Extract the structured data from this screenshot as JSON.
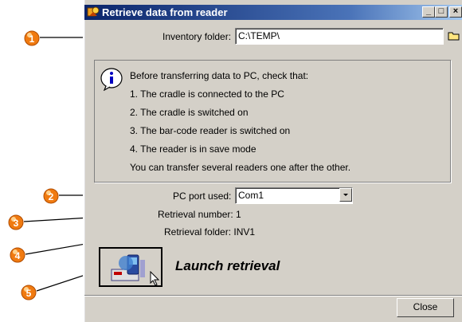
{
  "window": {
    "title": "Retrieve data from reader",
    "controls": {
      "minimize": "_",
      "maximize": "□",
      "close": "×"
    }
  },
  "inventory_folder": {
    "label": "Inventory folder:",
    "value": "C:\\TEMP\\"
  },
  "info": {
    "icon": "info-icon",
    "lines": [
      "Before transferring data to PC, check that:",
      "1. The cradle is connected to the PC",
      "2. The cradle is switched on",
      "3. The bar-code reader is switched on",
      "4. The reader is in save mode",
      "You can transfer several readers one after the other."
    ]
  },
  "pc_port": {
    "label": "PC port used:",
    "value": "Com1"
  },
  "retrieval_number": "Retrieval number: 1",
  "retrieval_folder": "Retrieval folder: INV1",
  "launch": {
    "label": "Launch retrieval",
    "icon": "pda-transfer-icon"
  },
  "close_button": "Close",
  "callouts": [
    "1",
    "2",
    "3",
    "4",
    "5"
  ],
  "colors": {
    "title_start": "#0a246a",
    "title_end": "#a6caf0",
    "dialog_bg": "#d4d0c8",
    "callout_orange": "#f07a10"
  }
}
